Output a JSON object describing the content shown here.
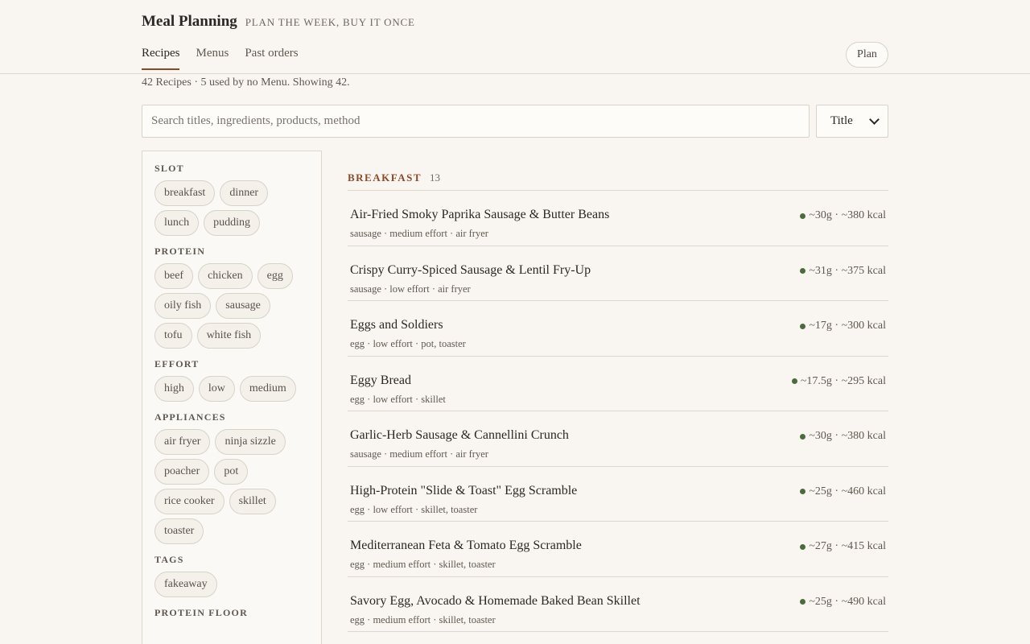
{
  "app": {
    "title": "Meal Planning",
    "tagline": "PLAN THE WEEK, BUY IT ONCE"
  },
  "nav": {
    "tabs": [
      {
        "label": "Recipes",
        "active": true
      },
      {
        "label": "Menus",
        "active": false
      },
      {
        "label": "Past orders",
        "active": false
      }
    ],
    "plan_label": "Plan"
  },
  "summary": "42 Recipes · 5 used by no Menu. Showing 42.",
  "search": {
    "placeholder": "Search titles, ingredients, products, method",
    "value": ""
  },
  "sort": {
    "selected": "Title"
  },
  "filters": [
    {
      "heading": "SLOT",
      "chips": [
        "breakfast",
        "dinner",
        "lunch",
        "pudding"
      ]
    },
    {
      "heading": "PROTEIN",
      "chips": [
        "beef",
        "chicken",
        "egg",
        "oily fish",
        "sausage",
        "tofu",
        "white fish"
      ]
    },
    {
      "heading": "EFFORT",
      "chips": [
        "high",
        "low",
        "medium"
      ]
    },
    {
      "heading": "APPLIANCES",
      "chips": [
        "air fryer",
        "ninja sizzle",
        "poacher",
        "pot",
        "rice cooker",
        "skillet",
        "toaster"
      ]
    },
    {
      "heading": "TAGS",
      "chips": [
        "fakeaway"
      ]
    },
    {
      "heading": "PROTEIN FLOOR",
      "chips": []
    }
  ],
  "section": {
    "title": "BREAKFAST",
    "count": "13"
  },
  "recipes": [
    {
      "title": "Air-Fried Smoky Paprika Sausage & Butter Beans",
      "meta": "sausage · medium effort · air fryer",
      "nutrition": "~30g · ~380 kcal"
    },
    {
      "title": "Crispy Curry-Spiced Sausage & Lentil Fry-Up",
      "meta": "sausage · low effort · air fryer",
      "nutrition": "~31g · ~375 kcal"
    },
    {
      "title": "Eggs and Soldiers",
      "meta": "egg · low effort · pot, toaster",
      "nutrition": "~17g · ~300 kcal"
    },
    {
      "title": "Eggy Bread",
      "meta": "egg · low effort · skillet",
      "nutrition": "~17.5g · ~295 kcal"
    },
    {
      "title": "Garlic-Herb Sausage & Cannellini Crunch",
      "meta": "sausage · medium effort · air fryer",
      "nutrition": "~30g · ~380 kcal"
    },
    {
      "title": "High-Protein \"Slide & Toast\" Egg Scramble",
      "meta": "egg · low effort · skillet, toaster",
      "nutrition": "~25g · ~460 kcal"
    },
    {
      "title": "Mediterranean Feta & Tomato Egg Scramble",
      "meta": "egg · medium effort · skillet, toaster",
      "nutrition": "~27g · ~415 kcal"
    },
    {
      "title": "Savory Egg, Avocado & Homemade Baked Bean Skillet",
      "meta": "egg · medium effort · skillet, toaster",
      "nutrition": "~25g · ~490 kcal"
    }
  ],
  "colors": {
    "accent": "#8a4a28",
    "protein_dot": "#4b6b3e",
    "background": "#f9f6f1"
  }
}
